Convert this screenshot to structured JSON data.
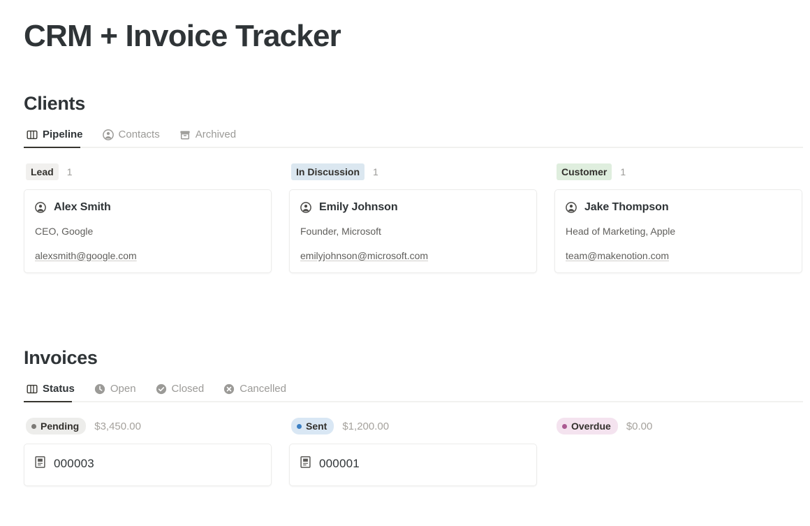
{
  "page": {
    "title": "CRM + Invoice Tracker"
  },
  "clients": {
    "heading": "Clients",
    "tabs": [
      {
        "label": "Pipeline",
        "icon": "board-icon",
        "active": true
      },
      {
        "label": "Contacts",
        "icon": "person-circle-icon",
        "active": false
      },
      {
        "label": "Archived",
        "icon": "archive-box-icon",
        "active": false
      }
    ],
    "columns": [
      {
        "label": "Lead",
        "count": "1",
        "chip_bg": "#f1f0ee",
        "chip_color": "#32302c",
        "cards": [
          {
            "name": "Alex Smith",
            "role": "CEO, Google",
            "email": "alexsmith@google.com",
            "icon": "person-circle-icon"
          }
        ]
      },
      {
        "label": "In Discussion",
        "count": "1",
        "chip_bg": "#dbe7f0",
        "chip_color": "#32302c",
        "cards": [
          {
            "name": "Emily Johnson",
            "role": "Founder, Microsoft",
            "email": "emilyjohnson@microsoft.com",
            "icon": "person-circle-icon"
          }
        ]
      },
      {
        "label": "Customer",
        "count": "1",
        "chip_bg": "#dfeede",
        "chip_color": "#32302c",
        "cards": [
          {
            "name": "Jake Thompson",
            "role": "Head of Marketing, Apple",
            "email": "team@makenotion.com",
            "icon": "person-circle-icon"
          }
        ]
      }
    ]
  },
  "invoices": {
    "heading": "Invoices",
    "tabs": [
      {
        "label": "Status",
        "icon": "board-icon",
        "active": true
      },
      {
        "label": "Open",
        "icon": "clock-icon",
        "active": false
      },
      {
        "label": "Closed",
        "icon": "check-circle-icon",
        "active": false
      },
      {
        "label": "Cancelled",
        "icon": "x-circle-icon",
        "active": false
      }
    ],
    "columns": [
      {
        "label": "Pending",
        "amount": "$3,450.00",
        "chip_bg": "#ededeb",
        "dot_color": "#7c7a76",
        "chip_color": "#32302c",
        "cards": [
          {
            "number": "000003",
            "icon": "page-icon"
          }
        ]
      },
      {
        "label": "Sent",
        "amount": "$1,200.00",
        "chip_bg": "#d9e7f4",
        "dot_color": "#3b7fc4",
        "chip_color": "#32302c",
        "cards": [
          {
            "number": "000001",
            "icon": "page-icon"
          }
        ]
      },
      {
        "label": "Overdue",
        "amount": "$0.00",
        "chip_bg": "#f4e3ef",
        "dot_color": "#ab5a92",
        "chip_color": "#32302c",
        "cards": []
      }
    ]
  }
}
